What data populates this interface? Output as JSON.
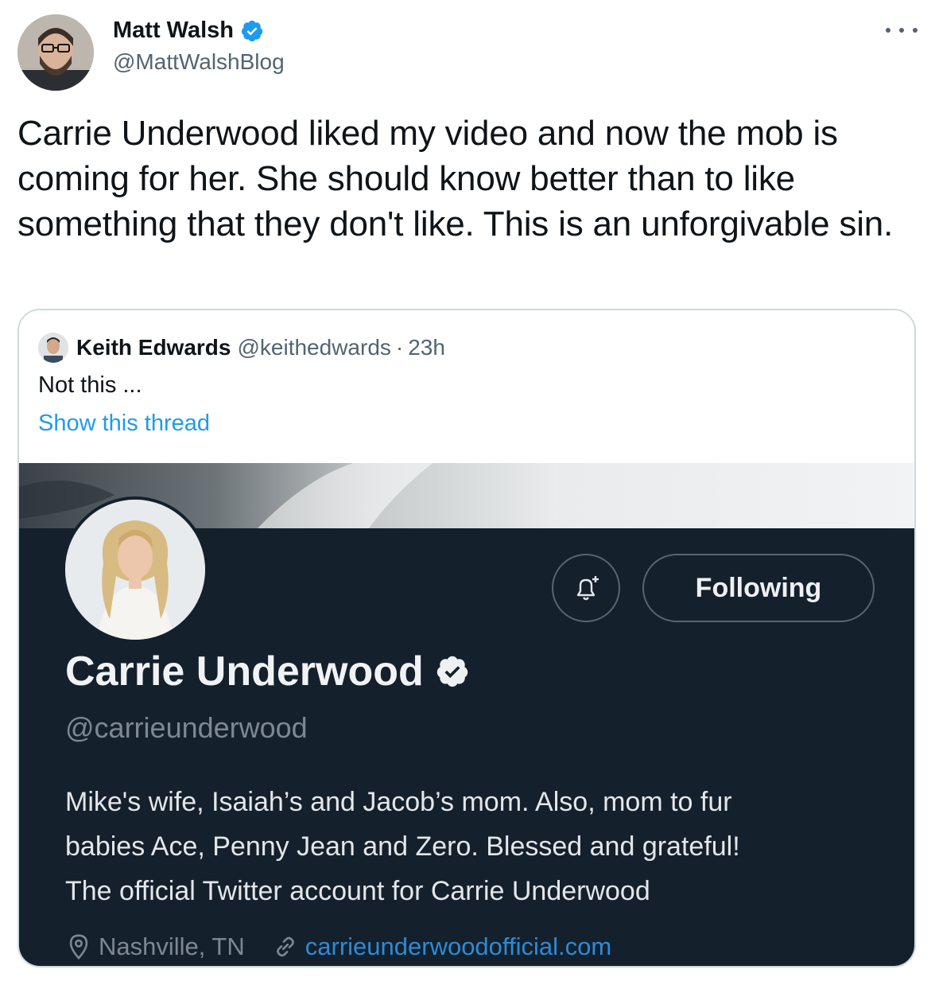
{
  "tweet": {
    "author_name": "Matt Walsh",
    "author_handle": "@MattWalshBlog",
    "text": "Carrie Underwood liked my video and now the mob is coming for her. She should know better than to like something that they don't like. This is an unforgivable sin."
  },
  "quoted_tweet": {
    "author_name": "Keith Edwards",
    "author_handle": "@keithedwards",
    "separator": "·",
    "time": "23h",
    "text": "Not this ...",
    "show_thread_label": "Show this thread"
  },
  "profile_screenshot": {
    "name": "Carrie Underwood",
    "handle": "@carrieunderwood",
    "following_label": "Following",
    "bio_lines": [
      "Mike's wife, Isaiah’s and Jacob’s mom. Also, mom to fur",
      "babies Ace, Penny Jean and Zero. Blessed and grateful!",
      "The official Twitter account for Carrie Underwood"
    ],
    "location": "Nashville, TN",
    "url": "carrieunderwoodofficial.com"
  },
  "icons": [
    "verified-badge-icon",
    "more-icon",
    "bell-plus-icon",
    "location-pin-icon",
    "link-icon"
  ],
  "colors": {
    "accent": "#1d9bf0",
    "secondary_text": "#536471",
    "profile_bg": "#14202c"
  }
}
